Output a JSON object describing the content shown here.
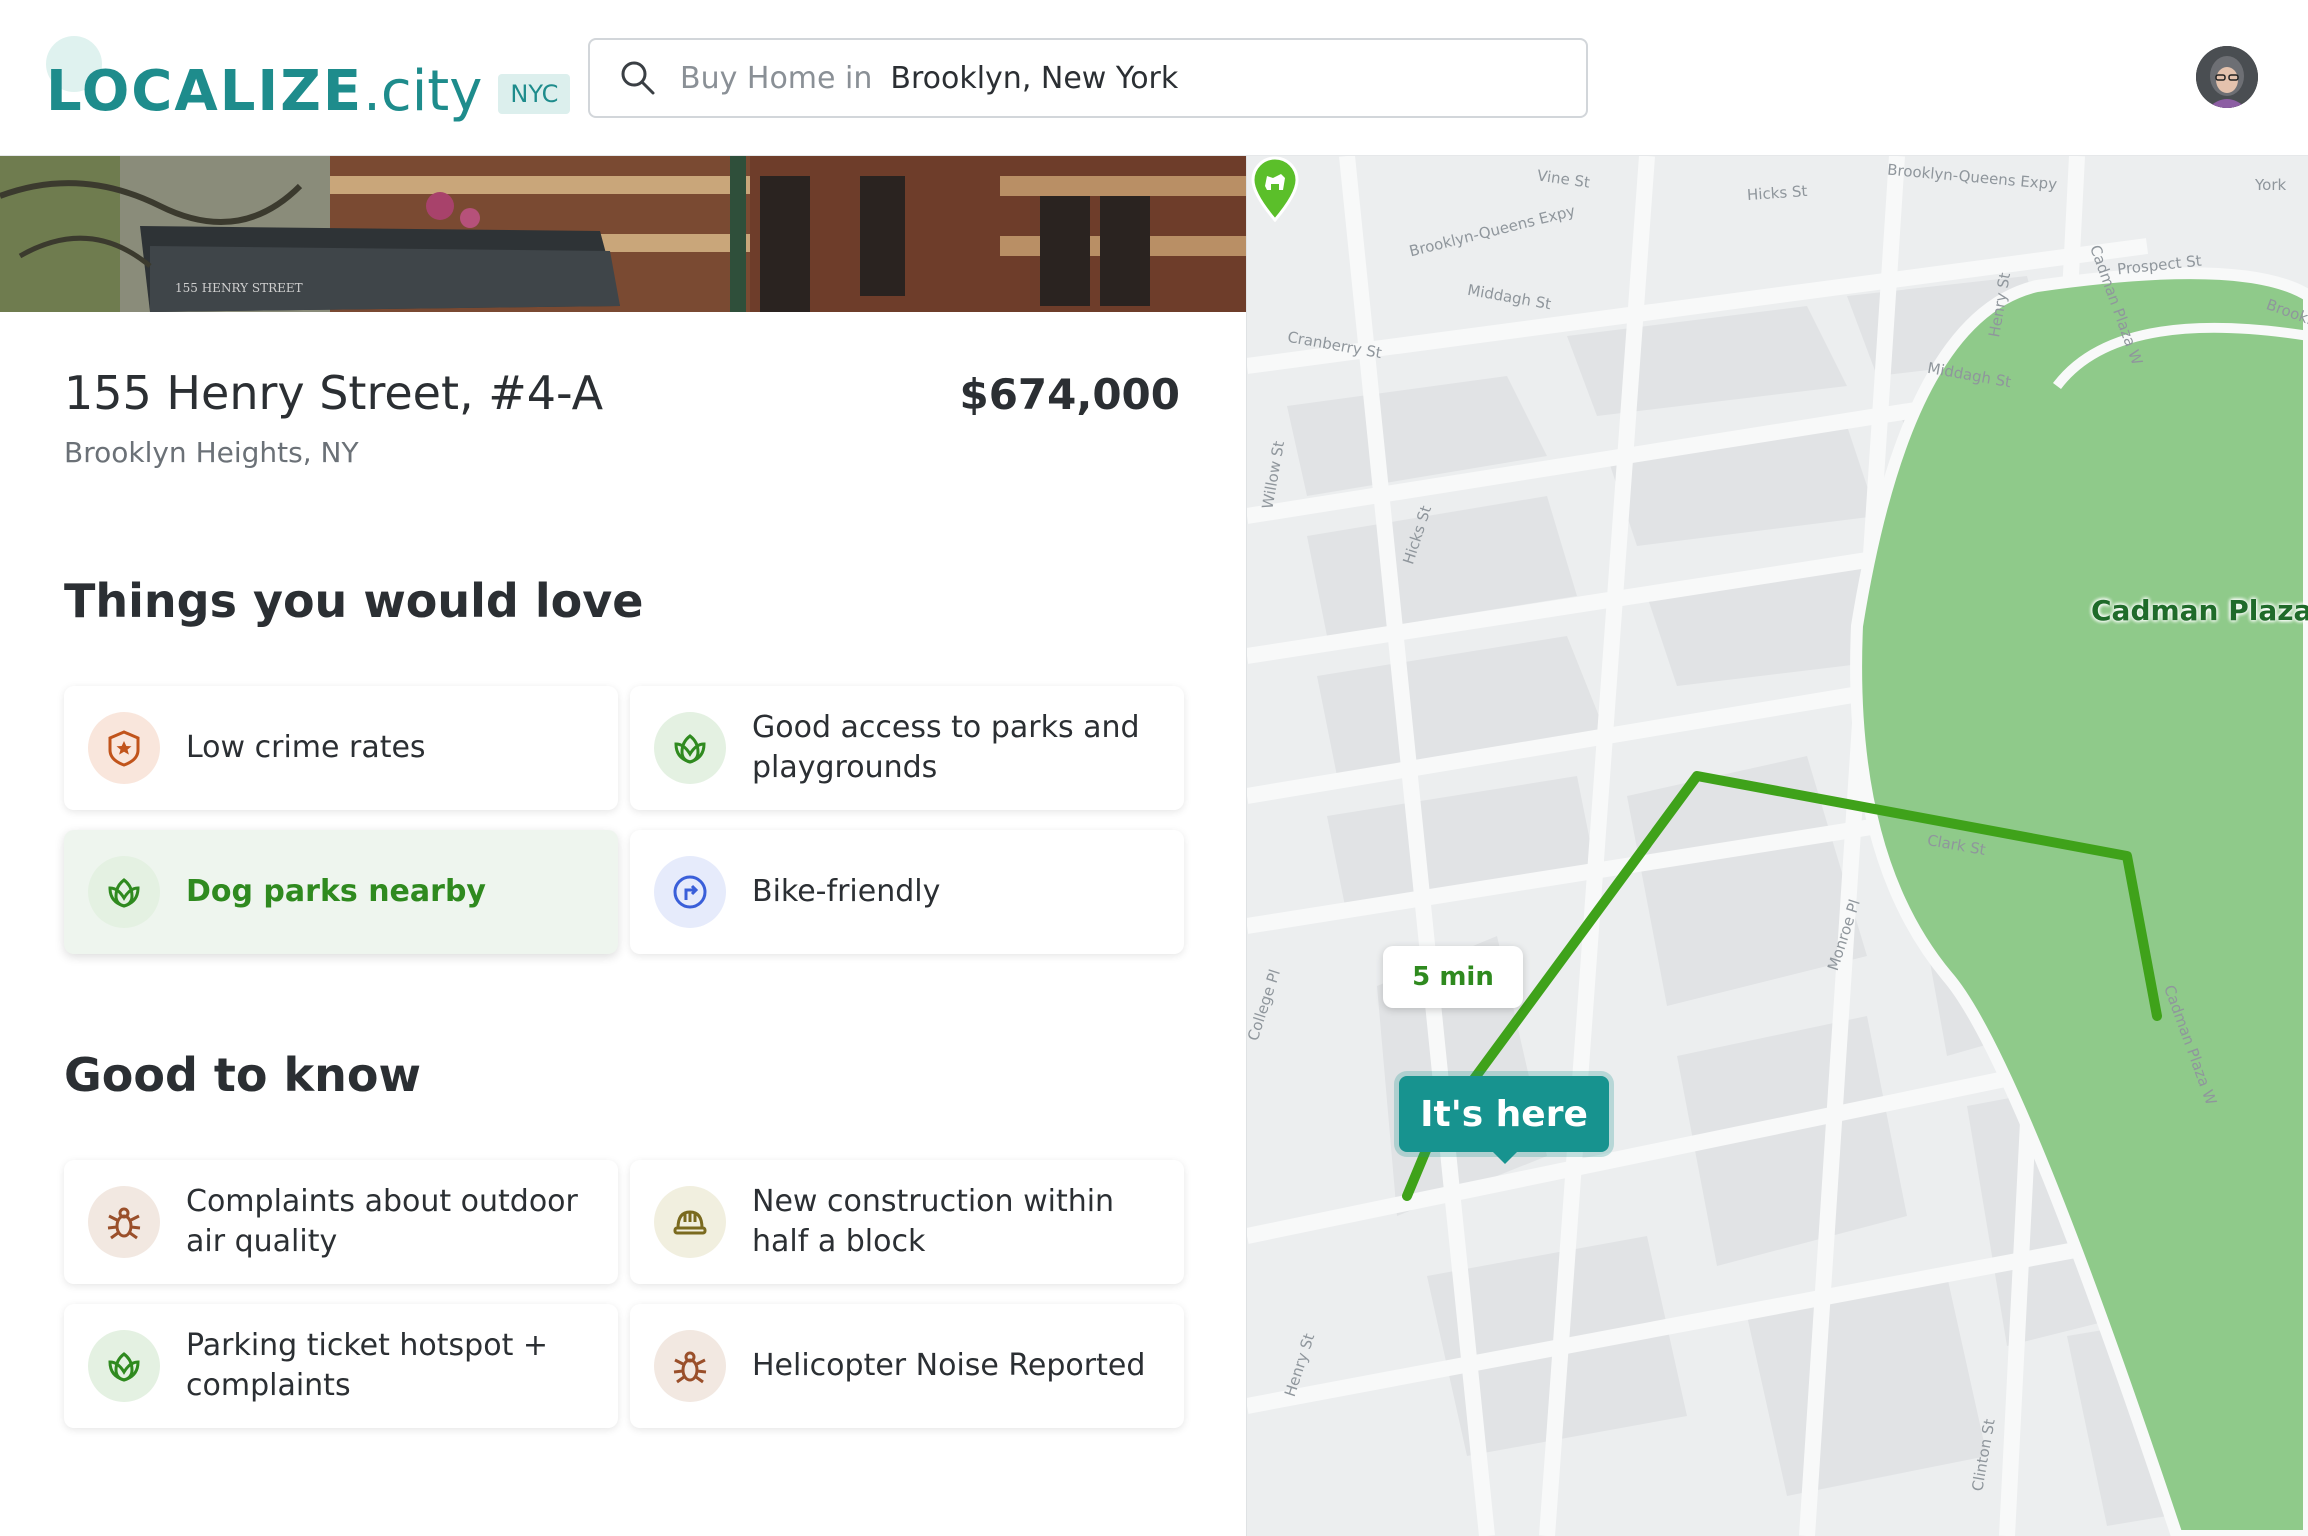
{
  "header": {
    "logo_text": "LOCALIZE",
    "logo_suffix": ".city",
    "logo_badge": "NYC",
    "search": {
      "prefix": "Buy Home in",
      "value": "Brooklyn, New York",
      "icon": "search-icon"
    },
    "avatar": "user-avatar"
  },
  "listing": {
    "photo_sign": "155 HENRY STREET",
    "address": "155 Henry Street, #4-A",
    "price": "$674,000",
    "locality": "Brooklyn Heights, NY"
  },
  "love_section": {
    "title": "Things you would love",
    "items": [
      {
        "label": "Low crime rates",
        "icon": "shield-star-icon"
      },
      {
        "label": "Good access to parks and playgrounds",
        "icon": "leaf-icon"
      },
      {
        "label": "Dog parks nearby",
        "icon": "leaf-icon",
        "active": true
      },
      {
        "label": "Bike-friendly",
        "icon": "directions-icon"
      }
    ]
  },
  "know_section": {
    "title": "Good to know",
    "items": [
      {
        "label": "Complaints about outdoor air quality",
        "icon": "bug-icon"
      },
      {
        "label": "New construction within half a block",
        "icon": "hardhat-icon"
      },
      {
        "label": "Parking ticket hotspot + complaints",
        "icon": "leaf-icon"
      },
      {
        "label": "Helicopter Noise Reported",
        "icon": "bug-icon"
      }
    ]
  },
  "map": {
    "route_time": "5 min",
    "marker_label": "It's here",
    "park_label": "Cadman Plaza P",
    "streets": [
      "Vine St",
      "Hicks St",
      "Brooklyn-Queens Expy",
      "Brooklyn-Queens Expy",
      "York",
      "Middagh St",
      "Cranberry St",
      "Prospect St",
      "Cadman Plaza W",
      "Brooklyn",
      "Middagh St",
      "Henry St",
      "Willow St",
      "Hicks St",
      "Clark St",
      "Monroe Pl",
      "College Pl",
      "Cadman Plaza W",
      "Henry St",
      "Clinton St"
    ]
  },
  "colors": {
    "brand": "#1e8c8c",
    "route": "#3fa21a",
    "park": "#8fca8a",
    "marker": "#17938f"
  }
}
